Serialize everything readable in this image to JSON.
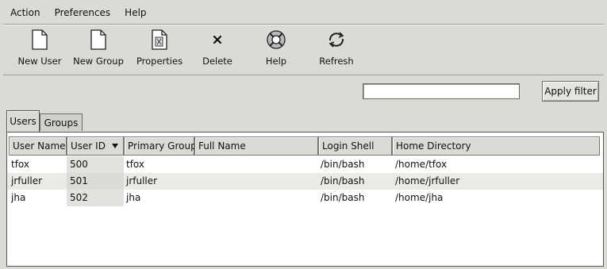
{
  "menubar": {
    "items": [
      {
        "label": "Action"
      },
      {
        "label": "Preferences"
      },
      {
        "label": "Help"
      }
    ]
  },
  "toolbar": {
    "buttons": [
      {
        "label": "New User",
        "icon": "new-user-icon"
      },
      {
        "label": "New Group",
        "icon": "new-group-icon"
      },
      {
        "label": "Properties",
        "icon": "properties-icon"
      },
      {
        "label": "Delete",
        "icon": "delete-icon"
      },
      {
        "label": "Help",
        "icon": "help-lifebuoy-icon"
      },
      {
        "label": "Refresh",
        "icon": "refresh-icon"
      }
    ]
  },
  "filter": {
    "value": "",
    "apply_label": "Apply filter"
  },
  "tabs": [
    {
      "label": "Users",
      "active": true
    },
    {
      "label": "Groups",
      "active": false
    }
  ],
  "table": {
    "columns": [
      "User Name",
      "User ID",
      "Primary Group",
      "Full Name",
      "Login Shell",
      "Home Directory"
    ],
    "sorted_column": "User ID",
    "rows": [
      {
        "user_name": "tfox",
        "user_id": "500",
        "primary_group": "tfox",
        "full_name": "",
        "login_shell": "/bin/bash",
        "home_directory": "/home/tfox"
      },
      {
        "user_name": "jrfuller",
        "user_id": "501",
        "primary_group": "jrfuller",
        "full_name": "",
        "login_shell": "/bin/bash",
        "home_directory": "/home/jrfuller"
      },
      {
        "user_name": "jha",
        "user_id": "502",
        "primary_group": "jha",
        "full_name": "",
        "login_shell": "/bin/bash",
        "home_directory": "/home/jha"
      }
    ]
  },
  "colors": {
    "window_bg": "#dcdad5",
    "list_bg": "#ffffff",
    "alt_row": "#eceae6"
  }
}
